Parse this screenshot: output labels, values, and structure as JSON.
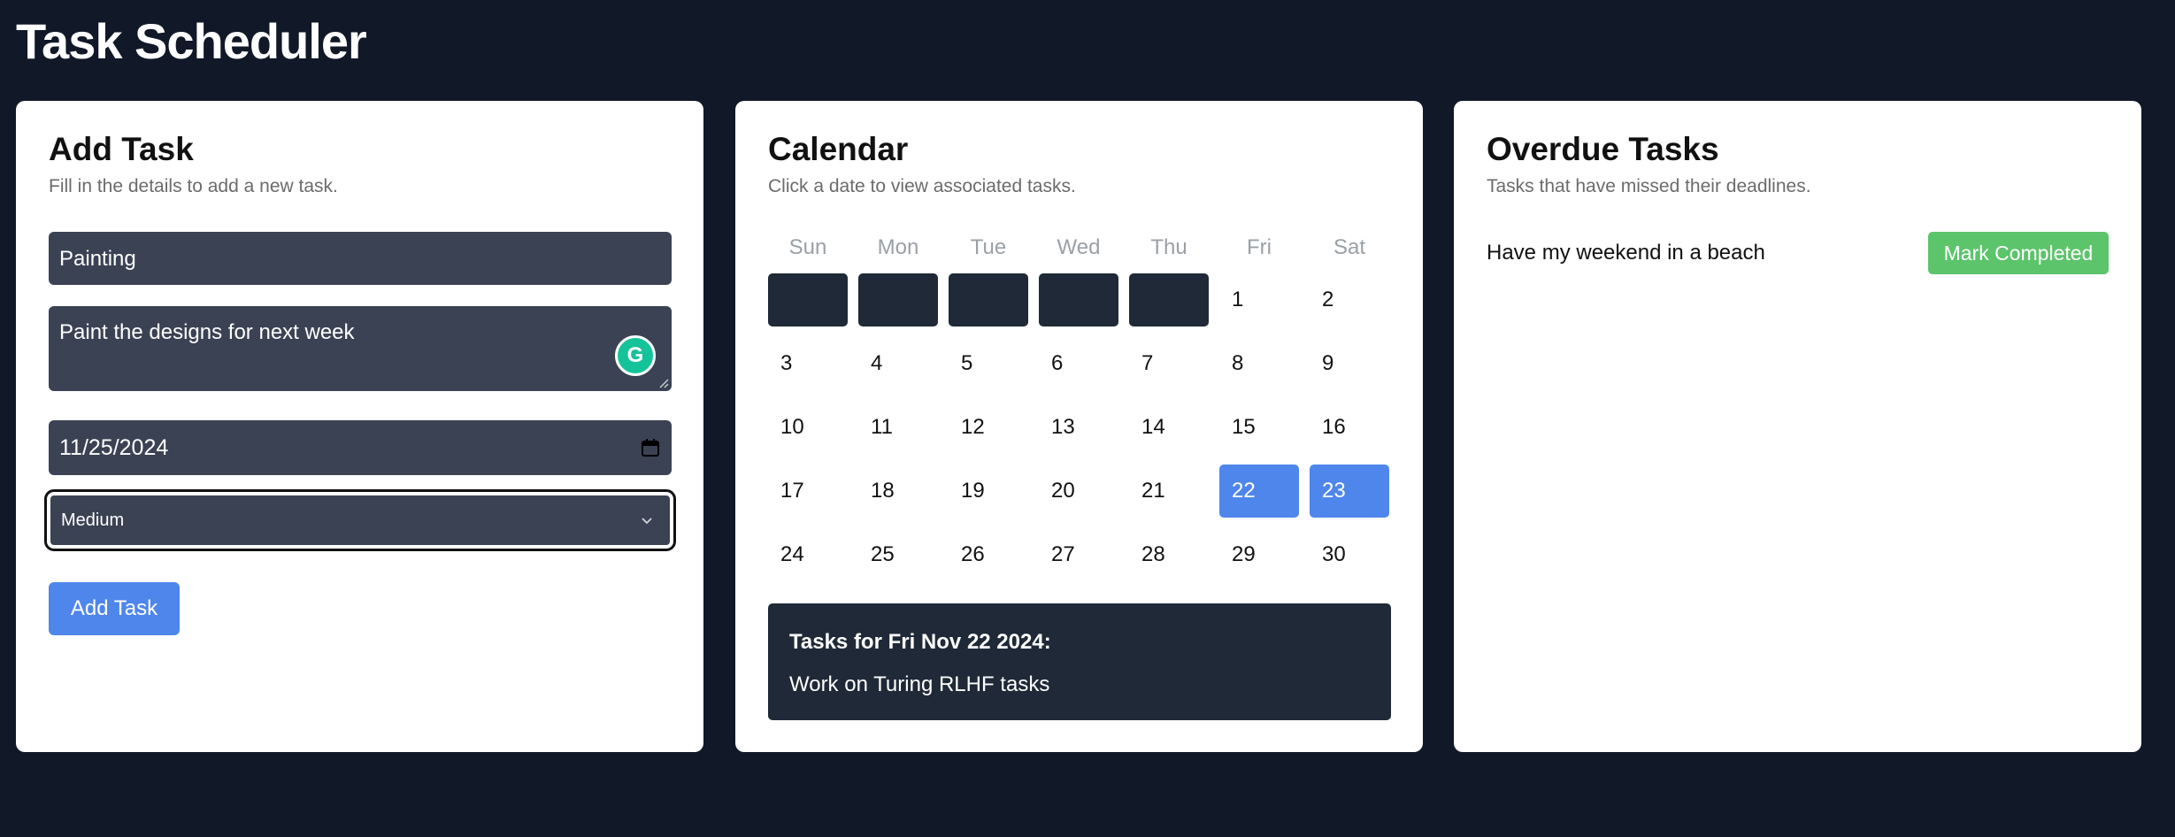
{
  "app": {
    "title": "Task Scheduler"
  },
  "add_task": {
    "title": "Add Task",
    "subtitle": "Fill in the details to add a new task.",
    "task_title_value": "Painting",
    "description_value": "Paint the designs for next week",
    "date_value": "11/25/2024",
    "priority_value": "Medium",
    "button_label": "Add Task"
  },
  "calendar": {
    "title": "Calendar",
    "subtitle": "Click a date to view associated tasks.",
    "weekdays": [
      "Sun",
      "Mon",
      "Tue",
      "Wed",
      "Thu",
      "Fri",
      "Sat"
    ],
    "leading_empty_days": 5,
    "days_in_month": 30,
    "highlighted_days": [
      22,
      23
    ],
    "selected_heading": "Tasks for Fri Nov 22 2024:",
    "selected_tasks": [
      "Work on Turing RLHF tasks"
    ],
    "highlight_color": "#4f86ec"
  },
  "overdue": {
    "title": "Overdue Tasks",
    "subtitle": "Tasks that have missed their deadlines.",
    "items": [
      {
        "name": "Have my weekend in a beach",
        "action_label": "Mark Completed"
      }
    ]
  },
  "icons": {
    "date_picker": "calendar-icon",
    "select": "chevron-down-icon",
    "writing_assistant": "grammarly-icon"
  }
}
